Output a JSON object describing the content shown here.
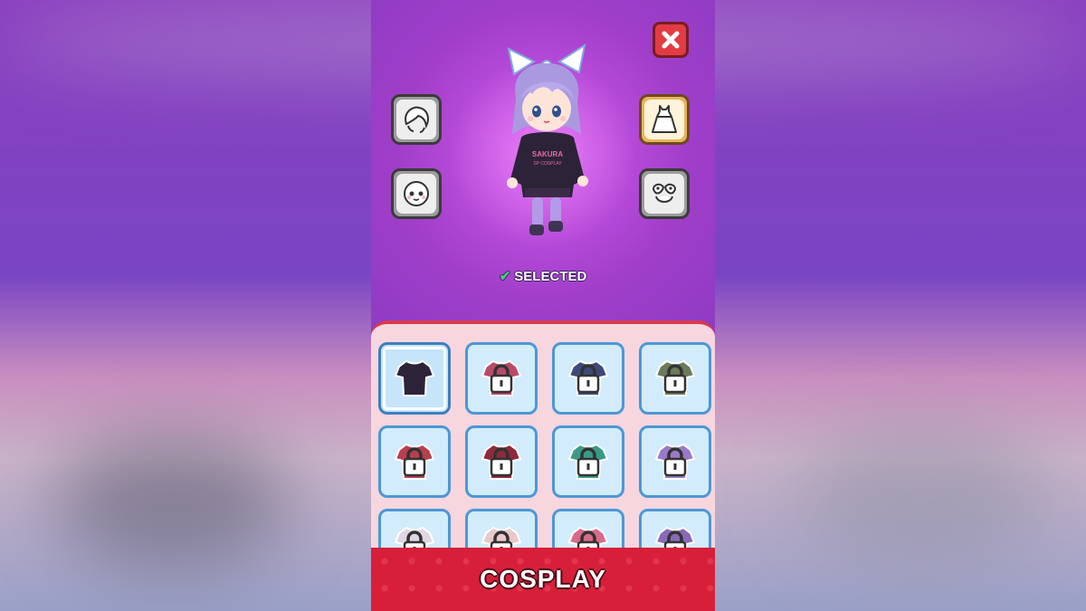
{
  "status": {
    "selected_label": "SELECTED"
  },
  "category": {
    "title": "COSPLAY"
  },
  "character": {
    "shirt_text": "SAKURA",
    "shirt_subtext": "SP COSPLAY"
  },
  "categories": [
    {
      "name": "hair",
      "icon": "hair-icon",
      "active": false
    },
    {
      "name": "dress",
      "icon": "dress-icon",
      "active": true
    },
    {
      "name": "face",
      "icon": "face-icon",
      "active": false
    },
    {
      "name": "mask",
      "icon": "mask-icon",
      "active": false
    }
  ],
  "items": [
    {
      "color": "#2d2338",
      "locked": false,
      "selected": true
    },
    {
      "color": "#b94a6a",
      "locked": true
    },
    {
      "color": "#3e4a7a",
      "locked": true
    },
    {
      "color": "#6a7a5a",
      "locked": true
    },
    {
      "color": "#b8404e",
      "locked": true
    },
    {
      "color": "#8e2a3e",
      "locked": true
    },
    {
      "color": "#3a9a8a",
      "locked": true
    },
    {
      "color": "#9a7ac8",
      "locked": true
    },
    {
      "color": "#e0d6e4",
      "locked": true
    },
    {
      "color": "#e8c8c8",
      "locked": true
    },
    {
      "color": "#d86a8a",
      "locked": true
    },
    {
      "color": "#8a6ab8",
      "locked": true
    }
  ],
  "colors": {
    "accent": "#d81f3a",
    "panel": "#f7d6de",
    "tile_border": "#4c97d6"
  }
}
